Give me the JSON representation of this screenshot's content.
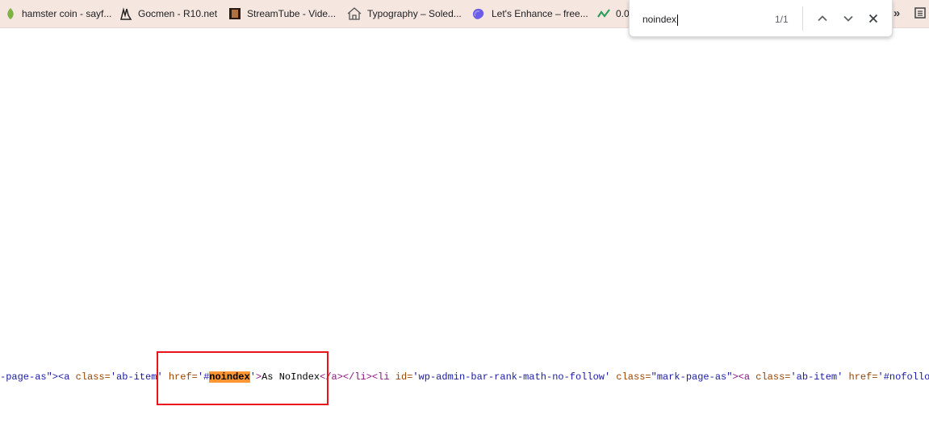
{
  "bookmarks": [
    {
      "label": "hamster coin - sayf...",
      "icon": "leaf-icon",
      "icon_color": "#7cb342",
      "left": 0
    },
    {
      "label": "Gocmen - R10.net",
      "icon": "fingers-icon",
      "icon_color": "#222222"
    },
    {
      "label": "StreamTube - Vide...",
      "icon": "thumbnail-icon",
      "icon_color": "#7a4a2a"
    },
    {
      "label": "Typography – Soled...",
      "icon": "house-icon",
      "icon_color": "#555555"
    },
    {
      "label": "Let's Enhance – free...",
      "icon": "blob-icon",
      "icon_color": "#6c5ce7"
    },
    {
      "label": "0.0",
      "icon": "chart-up-icon",
      "icon_color": "#2e9e5b"
    }
  ],
  "bookmarks_overflow": "»",
  "find_bar": {
    "query": "noindex",
    "count": "1/1"
  },
  "source": {
    "seg1": "-page-as\"><a ",
    "seg2": "class=",
    "seg3": "'ab-item'",
    "seg4": " href=",
    "seg5a": "'#",
    "seg5_match": "noindex",
    "seg5b": "'",
    "seg6": ">",
    "seg7": "As NoIndex",
    "seg8": "</a></li><li ",
    "seg9": "id=",
    "seg10": "'wp-admin-bar-rank-math-no-follow'",
    "seg11": " class=",
    "seg12": "\"mark-page-as\"",
    "seg13": "><a ",
    "seg14": "class=",
    "seg15": "'ab-item'",
    "seg16": " href=",
    "seg17": "'#nofollow'"
  },
  "colors": {
    "bookmark_bar_bg": "#f5e6e0",
    "highlight": "#ff9632",
    "annotation_border": "#e8141a"
  }
}
